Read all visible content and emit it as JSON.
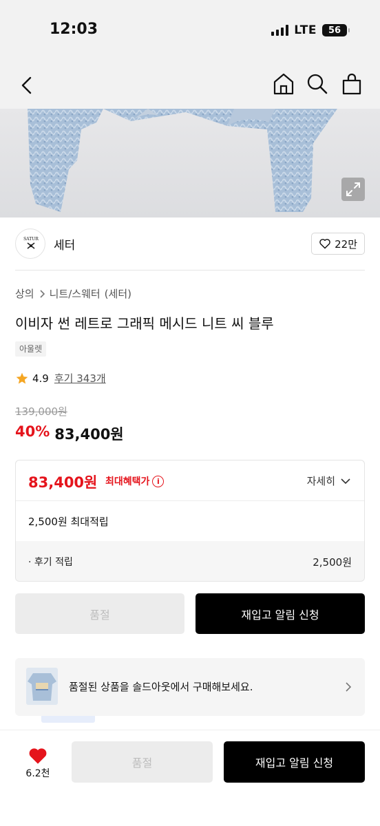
{
  "status": {
    "time": "12:03",
    "network": "LTE",
    "battery": "56"
  },
  "brand": {
    "name": "세터",
    "logo_text": "SATUR",
    "likes": "22만"
  },
  "breadcrumb": [
    "상의",
    "니트/스웨터",
    "(세터)"
  ],
  "product": {
    "title": "이비자 썬 레트로 그래픽 메시드 니트 씨 블루",
    "tag": "아울렛",
    "rating": "4.9",
    "reviews": "후기 343개",
    "original_price": "139,000원",
    "discount": "40%",
    "sale_price": "83,400원"
  },
  "benefit": {
    "price": "83,400원",
    "max_label": "최대혜택가",
    "info_icon": "i",
    "detail_label": "자세히",
    "points_label": "2,500원 최대적립",
    "review_label": "· 후기 적립",
    "review_value": "2,500원"
  },
  "actions": {
    "soldout": "품절",
    "restock": "재입고 알림 신청"
  },
  "banner": {
    "text": "품절된 상품을 솔드아웃에서 구매해보세요."
  },
  "bottom": {
    "wish_count": "6.2천",
    "soldout": "품절",
    "restock": "재입고 알림 신청"
  },
  "colors": {
    "accent_red": "#e5141c",
    "black": "#000000",
    "disabled": "#ececec",
    "star": "#f5a623"
  },
  "icons": [
    "back-icon",
    "home-icon",
    "search-icon",
    "shopping-bag-icon",
    "expand-icon",
    "heart-outline-icon",
    "chevron-right-icon",
    "star-icon",
    "info-icon",
    "chevron-down-icon",
    "heart-filled-icon"
  ]
}
